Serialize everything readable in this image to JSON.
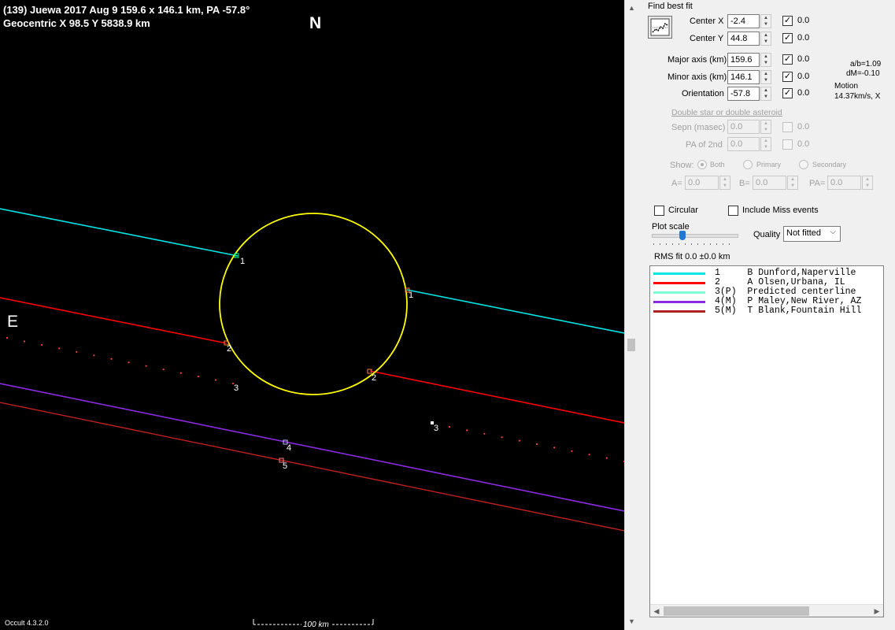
{
  "plot": {
    "title_line1": "(139) Juewa  2017 Aug 9   159.6 x 146.1 km, PA -57.8°",
    "title_line2": "Geocentric  X  98.5  Y 5838.9 km",
    "north": "N",
    "east": "E",
    "version": "Occult 4.3.2.0",
    "scale": "100 km",
    "chord_labels": {
      "c1_in": "1",
      "c1_out": "1",
      "c2_in": "2",
      "c2_out": "2",
      "c3_in": "3",
      "c3_out": "3",
      "c4": "4",
      "c5": "5"
    },
    "colors": {
      "background": "#000000",
      "ellipse": "#ffff00",
      "chord1": "#00e5e5",
      "chord2": "#ff0000",
      "chord3_dots": "#ff4040",
      "chord4": "#8a2be2",
      "chord5": "#c02020"
    }
  },
  "panel": {
    "find_best_fit": "Find best fit",
    "best_fit_icon": "chart-fit-icon",
    "center_x": {
      "label": "Center X",
      "value": "-2.4",
      "checked": true,
      "fit": "0.0"
    },
    "center_y": {
      "label": "Center Y",
      "value": "44.8",
      "checked": true,
      "fit": "0.0"
    },
    "major_axis": {
      "label": "Major axis (km)",
      "value": "159.6",
      "checked": true,
      "fit": "0.0"
    },
    "minor_axis": {
      "label": "Minor axis (km)",
      "value": "146.1",
      "checked": true,
      "fit": "0.0"
    },
    "orientation": {
      "label": "Orientation",
      "value": "-57.8",
      "checked": true,
      "fit": "0.0"
    },
    "ratio_ab": "a/b=1.09",
    "dm": "dM=-0.10",
    "motion_label": "Motion",
    "motion_value": "14.37km/s, X",
    "double_star_link": "Double star  or  double asteroid",
    "sepn": {
      "label": "Sepn (masec)",
      "value": "0.0",
      "fit": "0.0"
    },
    "pa_2nd": {
      "label": "PA of 2nd",
      "value": "0.0",
      "fit": "0.0"
    },
    "show_label": "Show:",
    "show_both": "Both",
    "show_primary": "Primary",
    "show_secondary": "Secondary",
    "a_label": "A=",
    "a_value": "0.0",
    "b_label": "B=",
    "b_value": "0.0",
    "pa_label": "PA=",
    "pa_value": "0.0",
    "circular": "Circular",
    "include_miss": "Include Miss events",
    "plot_scale": "Plot scale",
    "plot_scale_level": 0.5,
    "quality_label": "Quality",
    "quality_value": "Not fitted",
    "rms_fit": "RMS fit 0.0 ±0.0 km",
    "observers": [
      {
        "num": "1   ",
        "text": "B Dunford,Naperville",
        "color": "#00e5e5"
      },
      {
        "num": "2   ",
        "text": "A Olsen,Urbana, IL",
        "color": "#ff0000"
      },
      {
        "num": "3(P)",
        "text": "Predicted centerline",
        "color": "#7fffd4"
      },
      {
        "num": "4(M)",
        "text": "P Maley,New River, AZ",
        "color": "#8a2be2"
      },
      {
        "num": "5(M)",
        "text": "T Blank,Fountain Hill",
        "color": "#b22222"
      }
    ]
  }
}
